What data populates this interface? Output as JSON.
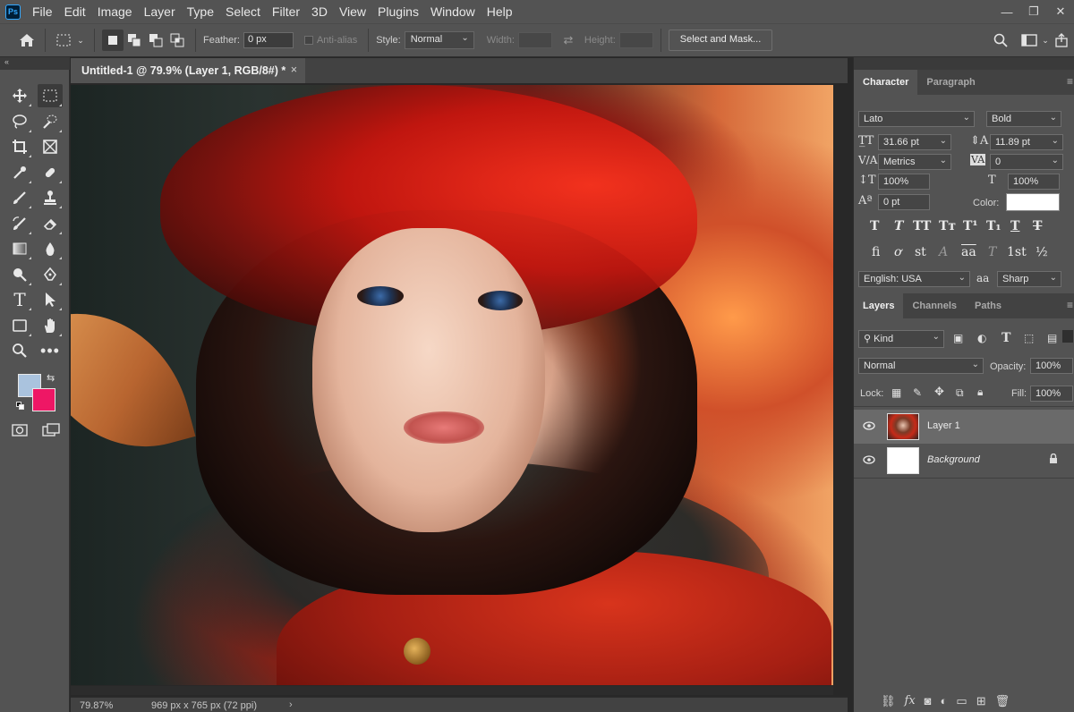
{
  "app": {
    "logo": "Ps"
  },
  "menu": [
    "File",
    "Edit",
    "Image",
    "Layer",
    "Type",
    "Select",
    "Filter",
    "3D",
    "View",
    "Plugins",
    "Window",
    "Help"
  ],
  "window_controls": {
    "minimize": "—",
    "restore": "❐",
    "close": "✕"
  },
  "options_bar": {
    "feather_label": "Feather:",
    "feather_value": "0 px",
    "antialias_label": "Anti-alias",
    "style_label": "Style:",
    "style_value": "Normal",
    "width_label": "Width:",
    "height_label": "Height:",
    "select_mask_label": "Select and Mask..."
  },
  "document": {
    "tab_title": "Untitled-1 @ 79.9% (Layer 1, RGB/8#) *",
    "tab_close": "×",
    "zoom_status": "79.87%",
    "size_status": "969 px x 765 px (72 ppi)",
    "status_arrow": "›"
  },
  "character_panel": {
    "tabs": [
      "Character",
      "Paragraph"
    ],
    "font_family": "Lato",
    "font_style": "Bold",
    "font_size": "31.66 pt",
    "leading": "11.89 pt",
    "kerning": "Metrics",
    "tracking": "0",
    "vertical_scale": "100%",
    "horizontal_scale": "100%",
    "baseline_shift": "0 pt",
    "color_label": "Color:",
    "color_value": "#ffffff",
    "language": "English: USA",
    "aa_icon_text": "aa",
    "antialias": "Sharp",
    "style_buttons": [
      "T",
      "T",
      "TT",
      "Tт",
      "T¹",
      "T₁",
      "T",
      "T"
    ],
    "opentype_buttons": [
      "fi",
      "ơ",
      "st",
      "A",
      "aa",
      "T",
      "1st",
      "½"
    ]
  },
  "layers_panel": {
    "tabs": [
      "Layers",
      "Channels",
      "Paths"
    ],
    "kind_label": "Kind",
    "blend_mode": "Normal",
    "opacity_label": "Opacity:",
    "opacity_value": "100%",
    "lock_label": "Lock:",
    "fill_label": "Fill:",
    "fill_value": "100%",
    "layers": [
      {
        "name": "Layer 1",
        "selected": true
      },
      {
        "name": "Background",
        "selected": false
      }
    ]
  },
  "icons": {
    "home": "home-icon",
    "marquee": "rect-marquee-icon",
    "move": "move-icon",
    "lasso": "lasso-icon",
    "crop": "crop-icon",
    "eyedropper": "eyedropper-icon",
    "brush": "brush-icon",
    "stamp": "clone-stamp-icon",
    "eraser": "eraser-icon",
    "gradient": "gradient-icon",
    "pen": "pen-icon",
    "type": "type-icon",
    "hand": "hand-icon",
    "zoom": "zoom-icon",
    "eye": "eye-icon",
    "lock": "lock-icon"
  },
  "colors": {
    "foreground": "#aac3de",
    "background": "#ee1765",
    "ui_bg": "#535353",
    "accent": "#31a8ff"
  }
}
